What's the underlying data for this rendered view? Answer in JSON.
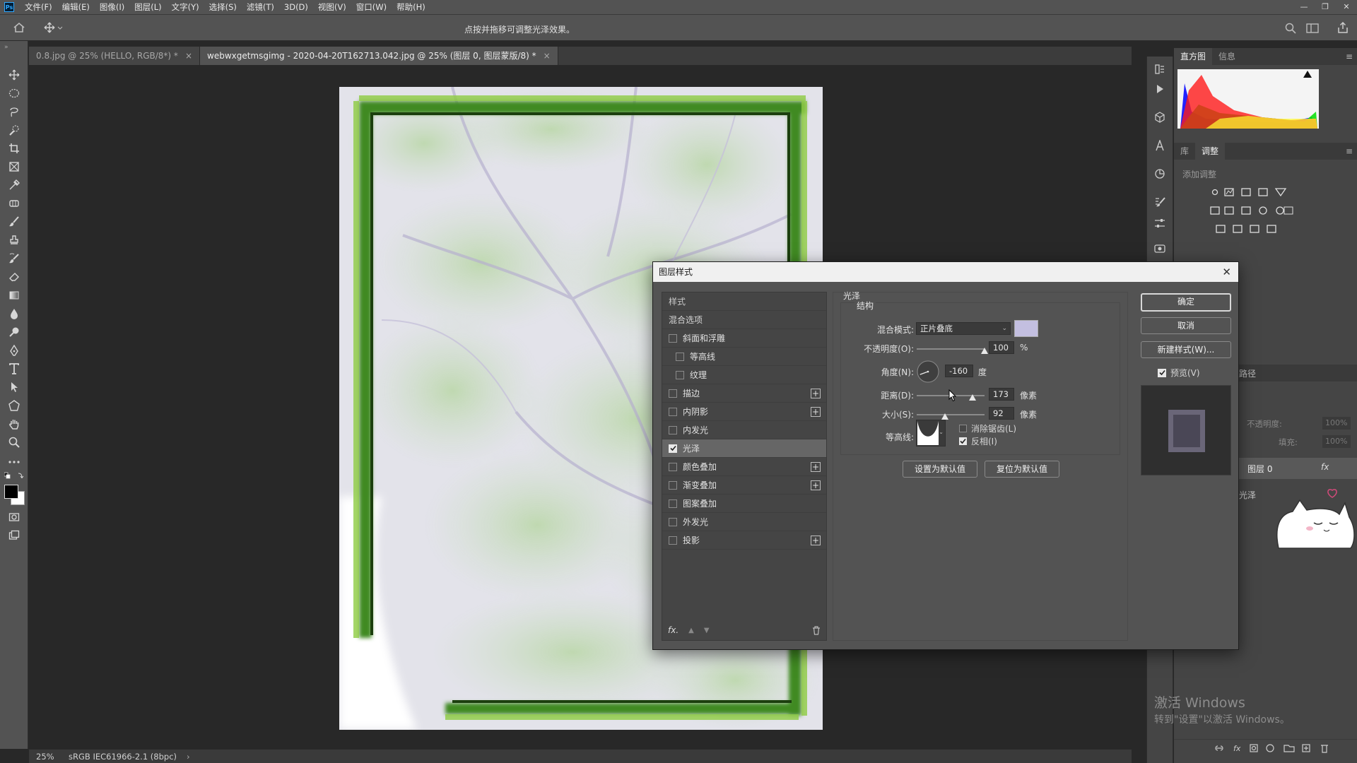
{
  "menubar": {
    "logo": "Ps",
    "items": [
      "文件(F)",
      "编辑(E)",
      "图像(I)",
      "图层(L)",
      "文字(Y)",
      "选择(S)",
      "滤镜(T)",
      "3D(D)",
      "视图(V)",
      "窗口(W)",
      "帮助(H)"
    ]
  },
  "options_bar": {
    "hint": "点按并拖移可调整光泽效果。"
  },
  "tabs": [
    {
      "label": "0.8.jpg @ 25% (HELLO, RGB/8*) *",
      "active": false
    },
    {
      "label": "webwxgetmsgimg - 2020-04-20T162713.042.jpg @ 25% (图层 0, 图层蒙版/8) *",
      "active": true
    }
  ],
  "status": {
    "zoom": "25%",
    "profile": "sRGB IEC61966-2.1 (8bpc)"
  },
  "right_panel": {
    "top_tabs": [
      "直方图",
      "信息"
    ],
    "adj_tabs": [
      "库",
      "调整"
    ],
    "adj_title": "添加调整",
    "layers": {
      "paths_tab": "路径",
      "opacity_label": "不透明度:",
      "opacity_value": "100%",
      "fill_label": "填充:",
      "fill_value": "100%",
      "layer_name": "图层 0",
      "effect_name": "光泽",
      "fx": "fx"
    },
    "watermark": {
      "title": "激活 Windows",
      "subtitle": "转到\"设置\"以激活 Windows。"
    }
  },
  "dialog": {
    "title": "图层样式",
    "list_header": "样式",
    "blend_options": "混合选项",
    "items": [
      {
        "label": "斜面和浮雕",
        "checked": false,
        "plus": false,
        "indent": false
      },
      {
        "label": "等高线",
        "checked": false,
        "plus": false,
        "indent": true
      },
      {
        "label": "纹理",
        "checked": false,
        "plus": false,
        "indent": true
      },
      {
        "label": "描边",
        "checked": false,
        "plus": true,
        "indent": false
      },
      {
        "label": "内阴影",
        "checked": false,
        "plus": true,
        "indent": false
      },
      {
        "label": "内发光",
        "checked": false,
        "plus": false,
        "indent": false
      },
      {
        "label": "光泽",
        "checked": true,
        "plus": false,
        "indent": false
      },
      {
        "label": "颜色叠加",
        "checked": false,
        "plus": true,
        "indent": false
      },
      {
        "label": "渐变叠加",
        "checked": false,
        "plus": true,
        "indent": false
      },
      {
        "label": "图案叠加",
        "checked": false,
        "plus": false,
        "indent": false
      },
      {
        "label": "外发光",
        "checked": false,
        "plus": false,
        "indent": false
      },
      {
        "label": "投影",
        "checked": false,
        "plus": true,
        "indent": false
      }
    ],
    "footer_fx": "fx.",
    "section_title": "光泽",
    "group_title": "结构",
    "blend_mode_label": "混合模式:",
    "blend_mode_value": "正片叠底",
    "swatch_color": "#c3bfe0",
    "opacity_label": "不透明度(O):",
    "opacity_value": "100",
    "opacity_fraction": 1.0,
    "opacity_unit": "%",
    "angle_label": "角度(N):",
    "angle_value": "-160",
    "angle_unit": "度",
    "distance_label": "距离(D):",
    "distance_value": "173",
    "distance_fraction": 0.82,
    "distance_unit": "像素",
    "size_label": "大小(S):",
    "size_value": "92",
    "size_fraction": 0.42,
    "size_unit": "像素",
    "contour_label": "等高线:",
    "anti_alias_label": "消除锯齿(L)",
    "anti_alias_checked": false,
    "invert_label": "反相(I)",
    "invert_checked": true,
    "set_default": "设置为默认值",
    "reset_default": "复位为默认值",
    "ok": "确定",
    "cancel": "取消",
    "new_style": "新建样式(W)...",
    "preview_label": "预览(V)",
    "preview_checked": true
  }
}
